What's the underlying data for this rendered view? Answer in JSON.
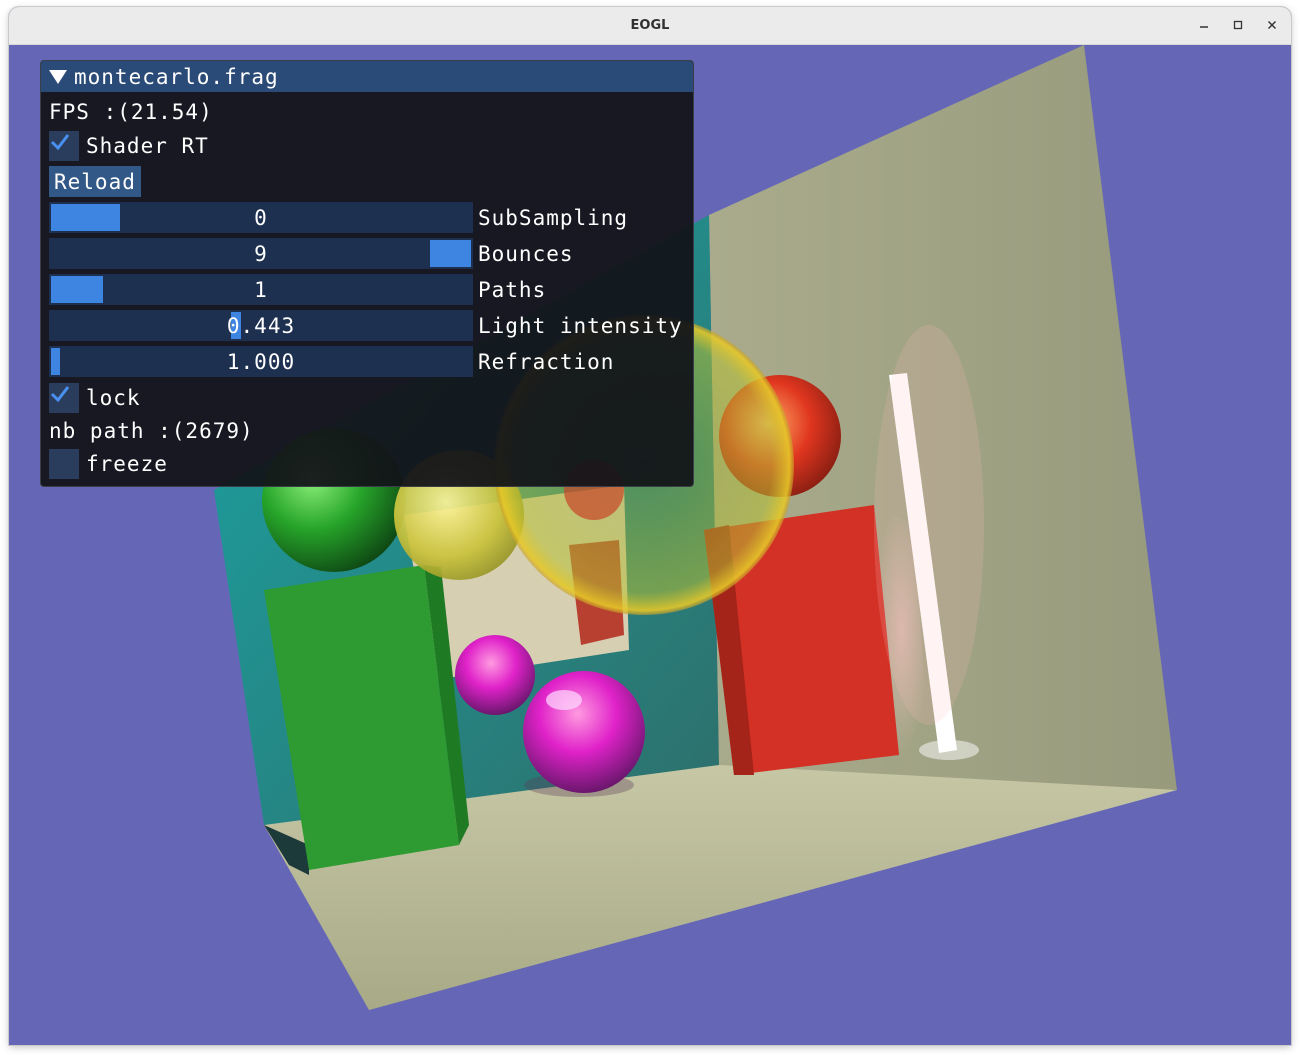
{
  "window": {
    "title": "EOGL",
    "minimize_icon": "minimize-icon",
    "maximize_icon": "maximize-icon",
    "close_icon": "close-icon"
  },
  "panel": {
    "title": "montecarlo.frag",
    "fps": "FPS :(21.54)",
    "shader_rt": {
      "label": "Shader RT",
      "checked": true
    },
    "reload_label": "Reload",
    "sliders": [
      {
        "label": "SubSampling",
        "value": "0",
        "fraction": 0.0
      },
      {
        "label": "Bounces",
        "value": "9",
        "fraction": 1.0
      },
      {
        "label": "Paths",
        "value": "1",
        "fraction": 0.0
      },
      {
        "label": "Light intensity",
        "value": "0.443",
        "fraction": 0.443
      },
      {
        "label": "Refraction",
        "value": "1.000",
        "fraction": 0.0
      }
    ],
    "lock": {
      "label": "lock",
      "checked": true
    },
    "nb_path": "nb path :(2679)",
    "freeze": {
      "label": "freeze",
      "checked": false
    }
  },
  "colors": {
    "background": "#6567b6",
    "accent": "#3d85e0",
    "header": "#2a4a78"
  }
}
